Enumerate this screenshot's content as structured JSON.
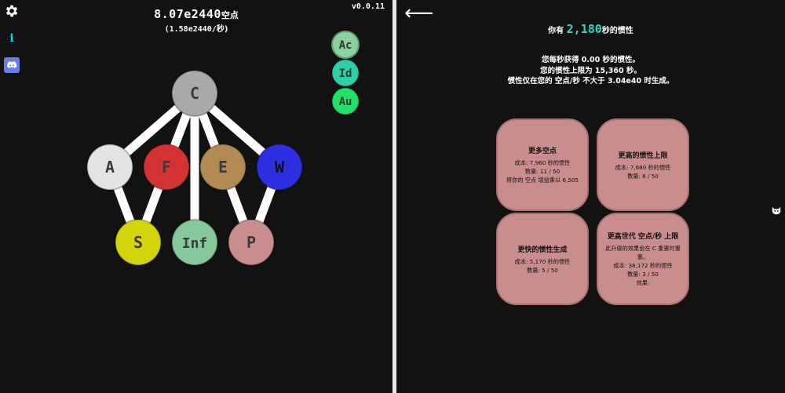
{
  "left": {
    "points_value": "8.07e2440",
    "points_unit": "空点",
    "rate_value": "(1.58e2440/",
    "rate_unit": "秒)",
    "version": "v0.0.11",
    "icons": [
      "gear-icon",
      "info-icon",
      "discord-icon"
    ],
    "info_glyph": "i",
    "side_nodes": [
      {
        "label": "Ac",
        "color": "#8cd0a0"
      },
      {
        "label": "Id",
        "color": "#2fd0a8"
      },
      {
        "label": "Au",
        "color": "#22e06a"
      }
    ],
    "tree": {
      "nodes": [
        {
          "id": "C",
          "label": "C",
          "color": "#a9a9a9"
        },
        {
          "id": "A",
          "label": "A",
          "color": "#e3e3e3"
        },
        {
          "id": "F",
          "label": "F",
          "color": "#d33333"
        },
        {
          "id": "E",
          "label": "E",
          "color": "#b18a54"
        },
        {
          "id": "W",
          "label": "W",
          "color": "#2e2ee0"
        },
        {
          "id": "S",
          "label": "S",
          "color": "#d4d40c"
        },
        {
          "id": "Inf",
          "label": "Inf",
          "color": "#86c79c"
        },
        {
          "id": "P",
          "label": "P",
          "color": "#c98d8d"
        }
      ]
    }
  },
  "right": {
    "back_glyph": "⟵",
    "you_have": "你有",
    "inertia_amount": "2,180",
    "inertia_suffix": "秒的惯性",
    "lines": [
      "您每秒获得 0.00 秒的惯性。",
      "您的惯性上限为 15,360 秒。",
      "惯性仅在您的 空点/秒 不大于 3.04e40 时生成。"
    ],
    "upgrades": [
      {
        "title": "更多空点",
        "lines": [
          "成本: 7,960 秒的惯性",
          "数量: 11 / 50",
          "将你的 空点 增益乘以 6,505"
        ]
      },
      {
        "title": "更高的惯性上限",
        "lines": [
          "成本: 7,680 秒的惯性",
          "数量: 8 / 50"
        ]
      },
      {
        "title": "更快的惯性生成",
        "lines": [
          "成本: 5,170 秒的惯性",
          "数量: 5 / 50"
        ]
      },
      {
        "title": "更高世代 空点/秒 上限",
        "lines": [
          "此升级的效果会在 C 重置时重置。",
          "成本: 38,172 秒的惯性",
          "数量: 3 / 50",
          "效果:"
        ]
      }
    ]
  }
}
